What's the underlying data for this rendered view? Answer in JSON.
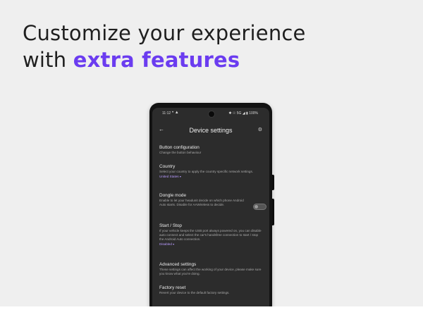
{
  "headline": {
    "line1": "Customize your experience",
    "line2_prefix": "with ",
    "line2_accent": "extra features"
  },
  "colors": {
    "accent": "#6b3cf0",
    "value_link": "#b99cff",
    "screen_bg": "#2c2c2c"
  },
  "status_bar": {
    "time": "11:12",
    "left_icons": "• ▲",
    "right": "✱ ☉ 5G ◢ ▮ 100%"
  },
  "app_bar": {
    "back_icon": "arrow-back-icon",
    "title": "Device settings",
    "gear_icon": "gear-icon"
  },
  "settings": {
    "button_config": {
      "title": "Button configuration",
      "desc": "Change the button behaviour"
    },
    "country": {
      "title": "Country",
      "desc": "Select your country to apply the country specific network settings.",
      "value": "United States"
    },
    "dongle": {
      "title": "Dongle mode",
      "desc": "Enable to let your headunit decide on which phone Android Auto starts. Disable for AAWireless to decide.",
      "toggle_on": false
    },
    "start_stop": {
      "title": "Start / Stop",
      "desc": "If your vehicle keeps the USB port always powered on, you can disable auto connect and select the car's handsfree connection to start / stop the Android Auto connection.",
      "value": "Disabled"
    },
    "advanced": {
      "title": "Advanced settings",
      "desc": "These settings can affect the working of your device, please make sure you know what you're doing."
    },
    "factory_reset": {
      "title": "Factory reset",
      "desc": "Revert your device to the default factory settings."
    }
  }
}
